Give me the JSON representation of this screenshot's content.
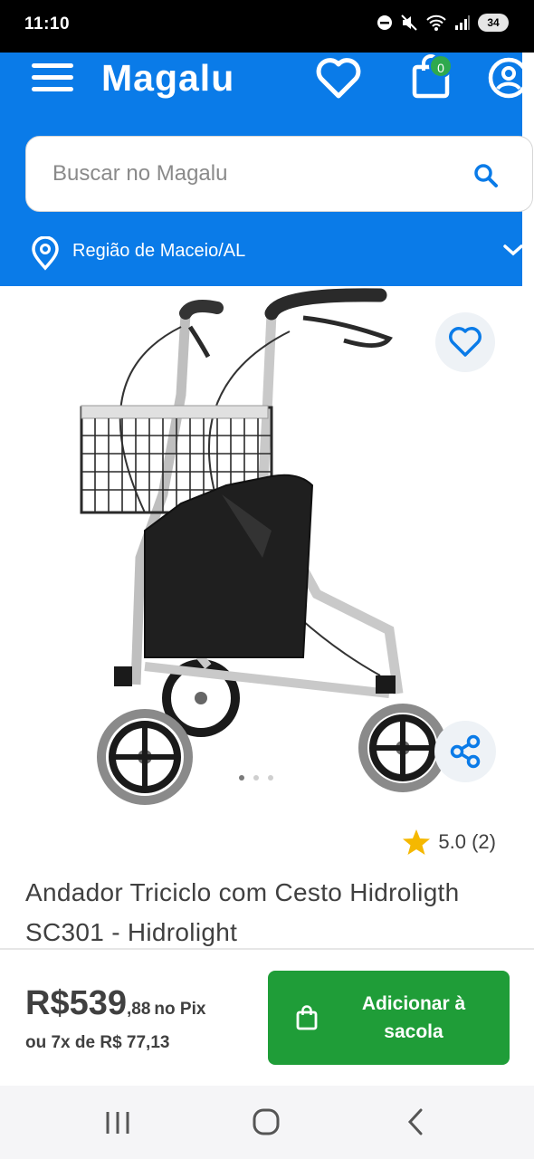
{
  "status_bar": {
    "time": "11:10",
    "battery": "34"
  },
  "header": {
    "logo": "Magalu",
    "cart_count": "0",
    "search_placeholder": "Buscar no Magalu",
    "region": "Região de Maceio/AL",
    "accent_color": "#0a7be8"
  },
  "product": {
    "image_icon": "rollator-walker-image",
    "carousel_pages": 3,
    "carousel_active": 1,
    "rating": "5.0 (2)",
    "title": "Andador Triciclo com Cesto Hidroligth SC301 - Hidrolight"
  },
  "price": {
    "integer": "R$539",
    "cents": ",88",
    "suffix": "no Pix",
    "installments": "ou 7x de R$ 77,13"
  },
  "cta": {
    "label": "Adicionar à sacola",
    "color": "#1f9d38"
  }
}
